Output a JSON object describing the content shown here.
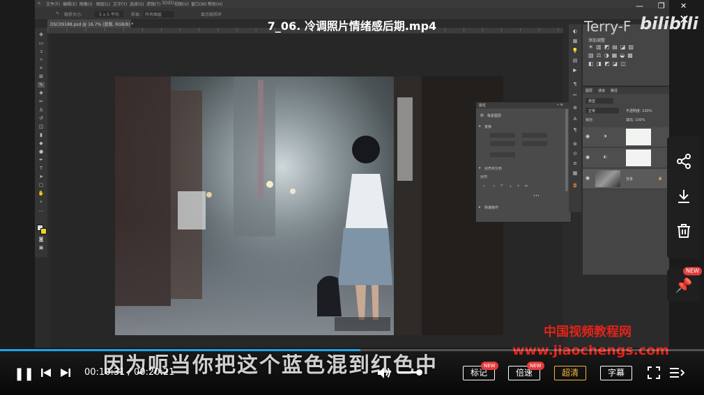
{
  "video": {
    "title": "7_06. 冷调照片情绪感后期.mp4",
    "uploader_watermark": "Terry-F",
    "platform_logo": "bilibili",
    "subtitle": "因为呃当你把这个蓝色混到红色中",
    "site_watermark_cn": "中国视频教程网",
    "site_watermark_url": "www.jiaochengs.com",
    "progress": 0.5123
  },
  "player": {
    "current_time": "00:10:31",
    "total_time": "00:20:21",
    "time_separator": " / ",
    "volume": 0.85,
    "buttons": {
      "mark_label": "标记",
      "speed_label": "倍速",
      "quality_label": "超清",
      "caption_label": "字幕",
      "new_badge": "NEW"
    },
    "accent_color": "#1aa6ec",
    "active_quality_color": "#f4b740"
  },
  "side_actions": {
    "share_icon": "share-icon",
    "download_icon": "download-icon",
    "delete_icon": "trash-icon",
    "pin_icon": "pin-icon",
    "new_badge": "NEW"
  },
  "photoshop": {
    "menus": [
      "文件(F)",
      "编辑(E)",
      "图像(I)",
      "图层(L)",
      "文字(Y)",
      "选择(S)",
      "滤镜(T)",
      "3D(D)",
      "视图(V)",
      "窗口(W)",
      "帮助(H)"
    ],
    "options": [
      "取样大小:",
      "5 x 5 平均",
      "样本:",
      "所有图层",
      "显示取样环"
    ],
    "doc_tab": "DSC09188.psd @ 16.7% (蓝版, RGB/8) *",
    "properties": {
      "header": "属性",
      "type": "像素图层",
      "transform_label": "变换",
      "align_label": "对齐并分布",
      "align_sub": "对齐:",
      "quick_label": "快速操作"
    },
    "panels": {
      "tabs": [
        "图层",
        "通道",
        "路径"
      ],
      "filter": "类型",
      "blend": "正常",
      "opacity": "不透明度: 100%",
      "lock": "锁定:",
      "fill": "填充: 100%"
    },
    "layers": [
      {
        "name": ""
      },
      {
        "name": ""
      },
      {
        "name": "背景"
      }
    ]
  }
}
